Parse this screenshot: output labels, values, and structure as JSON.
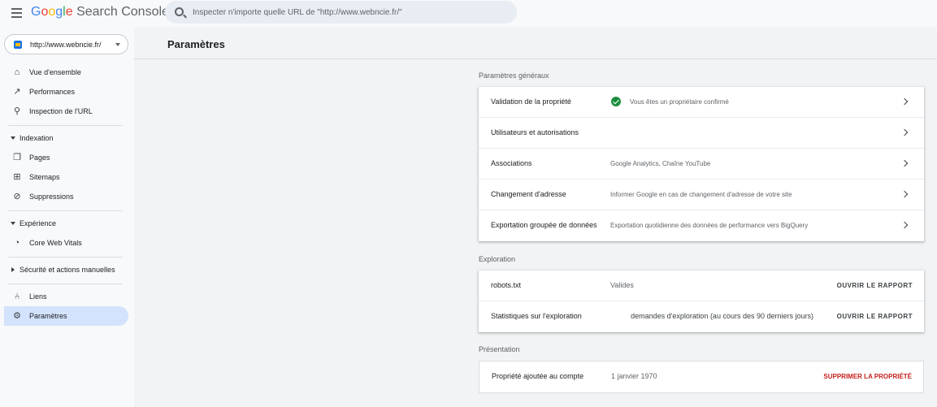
{
  "header": {
    "app_name": "Google Search Console",
    "logo_google": [
      "G",
      "o",
      "o",
      "g",
      "l",
      "e"
    ],
    "logo_suffix": " Search Console",
    "search_placeholder": "Inspecter n'importe quelle URL de \"http://www.webncie.fr/\""
  },
  "property": {
    "label": "http://www.webncie.fr/"
  },
  "sidebar": {
    "top_items": [
      {
        "label": "Vue d'ensemble",
        "icon": "home-icon"
      },
      {
        "label": "Performances",
        "icon": "trending-up-icon"
      },
      {
        "label": "Inspection de l'URL",
        "icon": "search-icon"
      }
    ],
    "sections": [
      {
        "label": "Indexation",
        "expanded": true,
        "items": [
          {
            "label": "Pages",
            "icon": "pages-icon"
          },
          {
            "label": "Sitemaps",
            "icon": "sitemap-icon"
          },
          {
            "label": "Suppressions",
            "icon": "removals-icon"
          }
        ]
      },
      {
        "label": "Expérience",
        "expanded": true,
        "items": [
          {
            "label": "Core Web Vitals",
            "icon": "gauge-icon"
          }
        ]
      },
      {
        "label": "Sécurité et actions manuelles",
        "expanded": false,
        "items": []
      }
    ],
    "bottom_items": [
      {
        "label": "Liens",
        "icon": "links-icon"
      },
      {
        "label": "Paramètres",
        "icon": "gear-icon",
        "active": true
      }
    ]
  },
  "main": {
    "title": "Paramètres",
    "general": {
      "label": "Paramètres généraux",
      "rows": [
        {
          "title": "Validation de la propriété",
          "value": "Vous êtes un propriétaire confirmé",
          "status": "check"
        },
        {
          "title": "Utilisateurs et autorisations",
          "value": ""
        },
        {
          "title": "Associations",
          "value": "Google Analytics, Chaîne YouTube"
        },
        {
          "title": "Changement d'adresse",
          "value": "Informer Google en cas de changement d'adresse de votre site"
        },
        {
          "title": "Exportation groupée de données",
          "value": "Exportation quotidienne des données de performance vers BigQuery"
        }
      ]
    },
    "exploration": {
      "label": "Exploration",
      "rows": [
        {
          "title": "robots.txt",
          "value": "Valides",
          "action": "OUVRIR LE RAPPORT"
        },
        {
          "title": "Statistiques sur l'exploration",
          "value": "demandes d'exploration (au cours des 90 derniers jours)",
          "action": "OUVRIR LE RAPPORT"
        }
      ]
    },
    "presentation": {
      "label": "Présentation",
      "rows": [
        {
          "title": "Propriété ajoutée au compte",
          "value": "1 janvier 1970",
          "action": "SUPPRIMER LA PROPRIÉTÉ"
        }
      ]
    }
  },
  "colors": {
    "accent": "#1a73e8",
    "active_bg": "#d3e3fd",
    "success": "#1e8e3e",
    "danger": "#c5221f"
  }
}
